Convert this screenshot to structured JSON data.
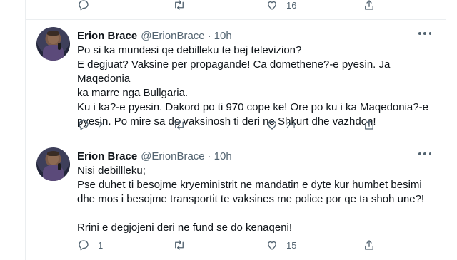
{
  "top_actions": {
    "reply_count": "",
    "retweet_count": "",
    "like_count": "16"
  },
  "tweets": [
    {
      "author": "Erion Brace",
      "handle": "@ErionBrace",
      "separator": "·",
      "time": "10h",
      "lines": [
        "Po si ka mundesi qe debilleku te bej televizion?",
        "E degjuat? Vaksine per propagande! Ca domethene?-e pyesin. Ja Maqedonia",
        "ka marre nga Bullgaria.",
        "Ku i ka?-e pyesin. Dakord po ti 970 cope ke! Ore po ku i ka Maqedonia?-e",
        "pyesin. Po mire sa do vaksinosh ti deri ne Shkurt dhe vazhdon!"
      ],
      "reply_count": "2",
      "retweet_count": "",
      "like_count": "21"
    },
    {
      "author": "Erion Brace",
      "handle": "@ErionBrace",
      "separator": "·",
      "time": "10h",
      "lines": [
        "Nisi debillleku;",
        "Pse duhet ti besojme kryeministrit ne mandatin e dyte kur humbet besimi",
        "dhe mos i besojme transportit te vaksines me police por qe ta shoh une?!",
        "",
        "Rrini e degjojeni deri ne fund se do kenaqeni!"
      ],
      "reply_count": "1",
      "retweet_count": "",
      "like_count": "15"
    }
  ],
  "icons": {
    "reply": "reply-icon",
    "retweet": "retweet-icon",
    "like": "heart-icon",
    "share": "share-icon",
    "more": "more-icon"
  },
  "colors": {
    "text": "#0f1419",
    "secondary": "#536471",
    "border": "#ebeef0"
  }
}
